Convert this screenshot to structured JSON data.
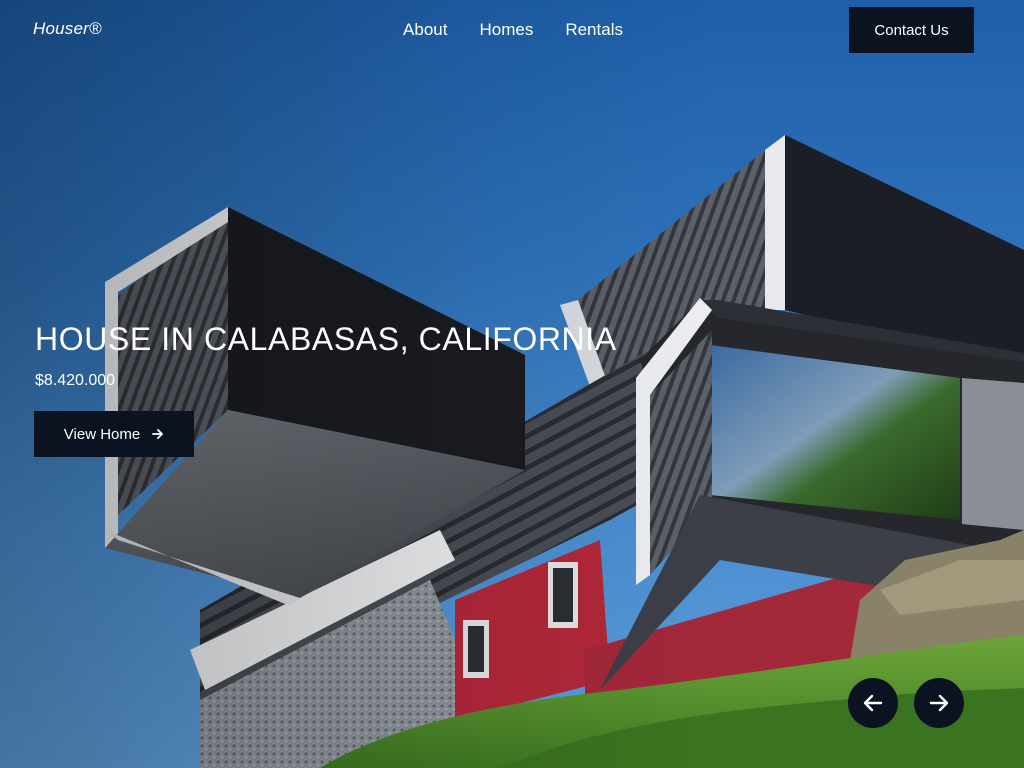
{
  "header": {
    "logo": "Houser®",
    "nav": [
      "About",
      "Homes",
      "Rentals"
    ],
    "contact_label": "Contact Us"
  },
  "hero": {
    "title": "HOUSE IN CALABASAS, CALIFORNIA",
    "price": "$8.420.000",
    "cta_label": "View Home",
    "cta_icon": "arrow-right-icon",
    "prev_icon": "arrow-left-icon",
    "next_icon": "arrow-right-icon"
  },
  "colors": {
    "sky": "#2f73bb",
    "button_bg": "#0b1320",
    "text": "#ffffff"
  }
}
